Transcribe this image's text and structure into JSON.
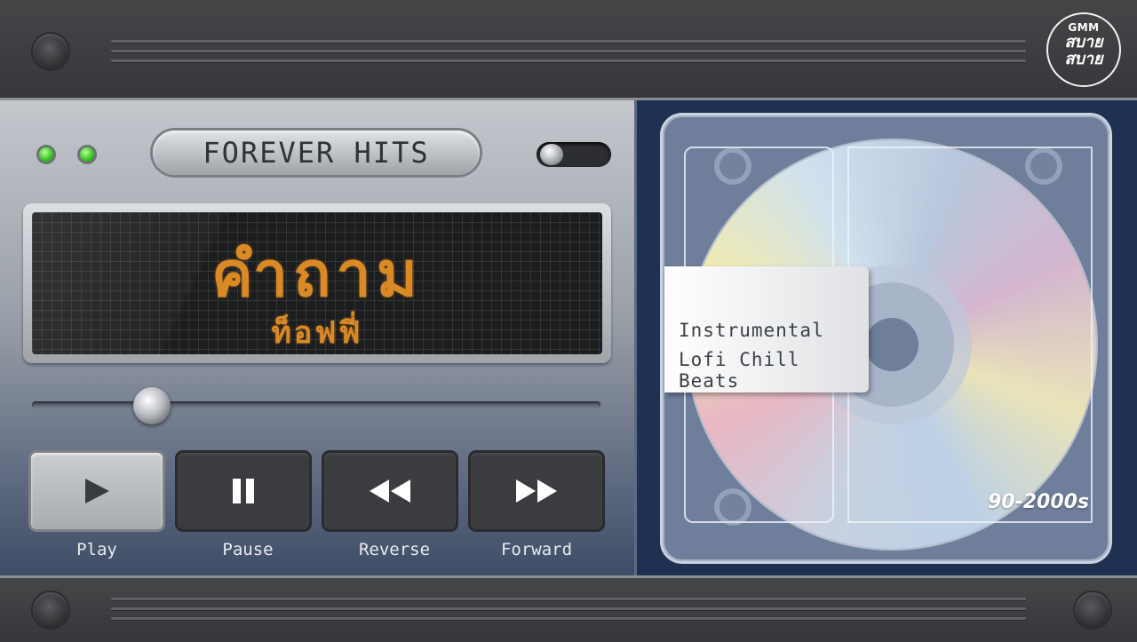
{
  "header": {
    "logo_top": "GMM",
    "logo_line1": "สบาย",
    "logo_line2": "สบาย"
  },
  "player": {
    "playlist_title": "FOREVER HITS",
    "now_playing": {
      "song_title": "คำถาม",
      "artist": "ท็อฟฟี่"
    },
    "progress": 0.19,
    "controls": [
      {
        "name": "play",
        "label": "Play",
        "icon": "play-icon",
        "active": true
      },
      {
        "name": "pause",
        "label": "Pause",
        "icon": "pause-icon",
        "active": false
      },
      {
        "name": "reverse",
        "label": "Reverse",
        "icon": "rewind-icon",
        "active": false
      },
      {
        "name": "forward",
        "label": "Forward",
        "icon": "fast-forward-icon",
        "active": false
      }
    ]
  },
  "disc": {
    "label_line1": "Instrumental",
    "label_line2": "Lofi Chill Beats",
    "era": "90-2000s"
  },
  "colors": {
    "display_text": "#d98a25",
    "led": "#35c21f",
    "panel_right": "#1f3152"
  }
}
